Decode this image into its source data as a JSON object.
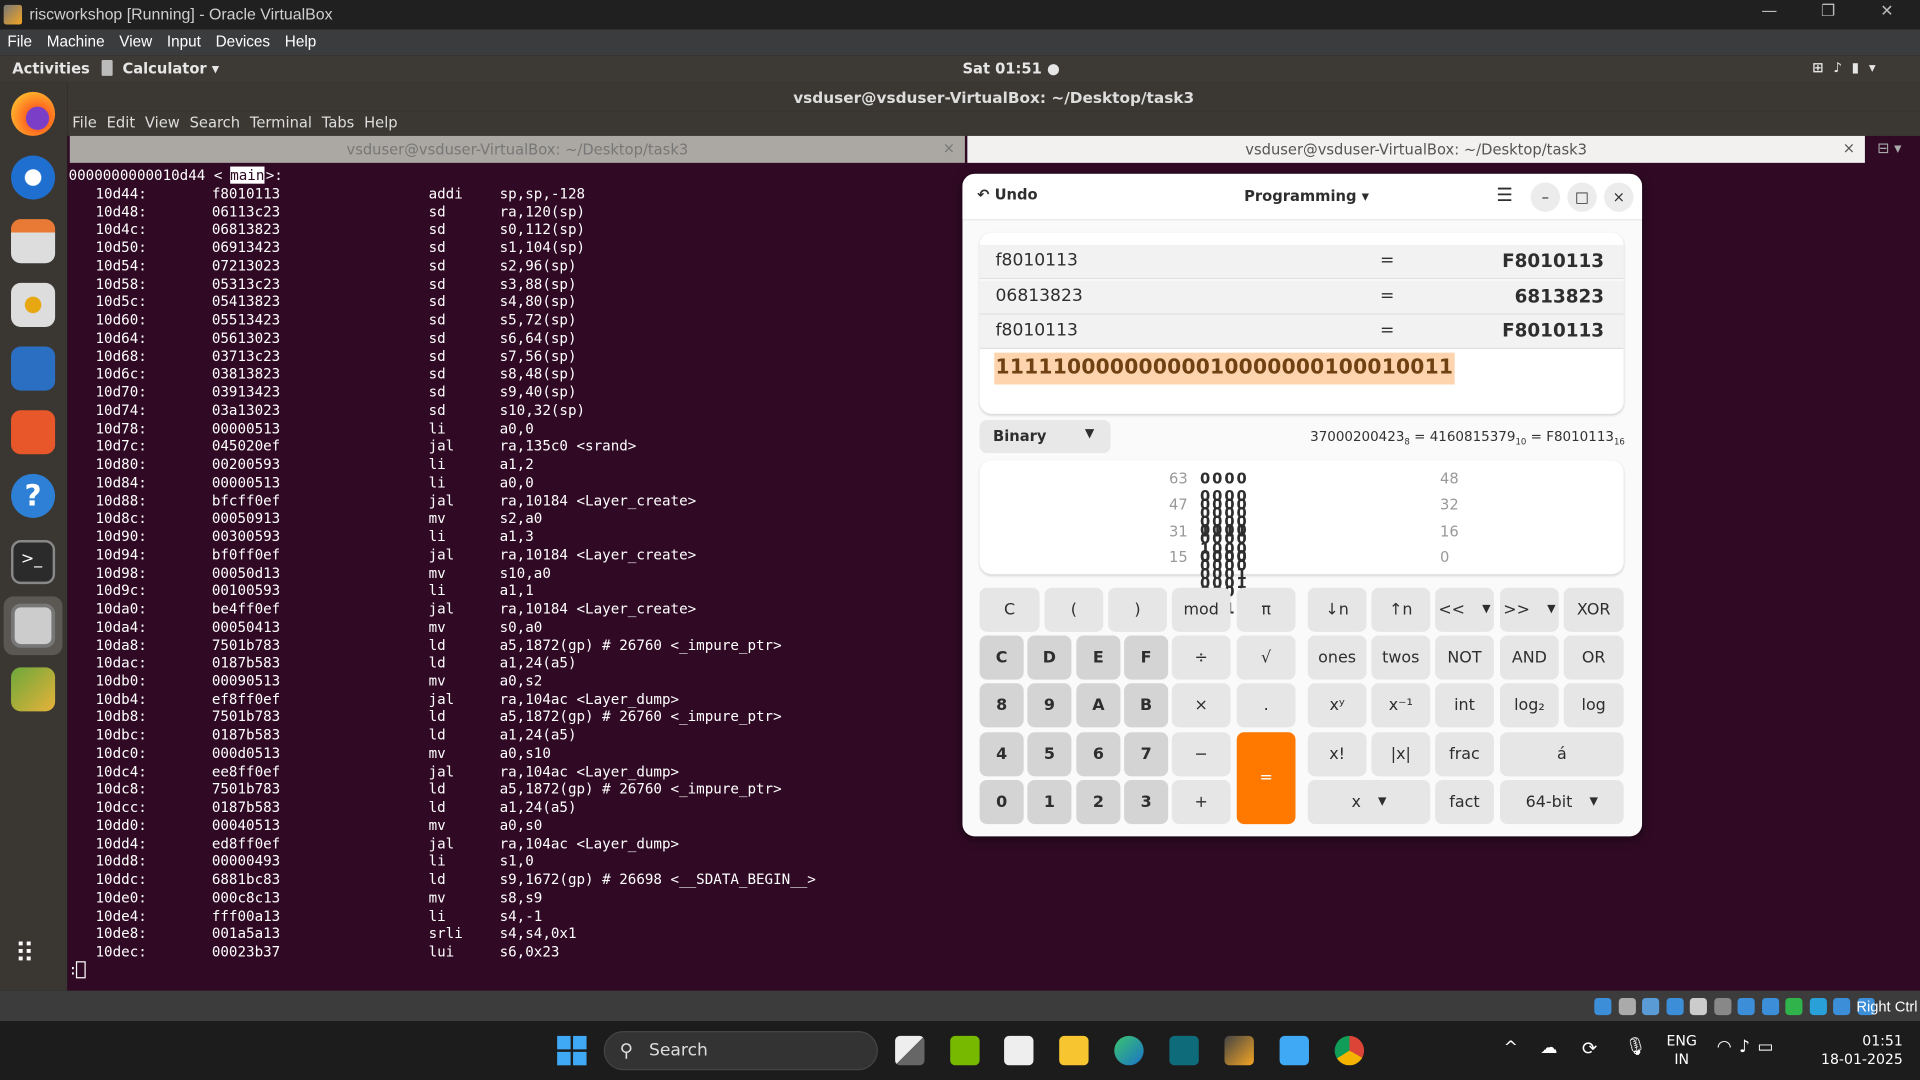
{
  "vbox": {
    "title": "riscworkshop [Running] - Oracle VirtualBox",
    "menu": [
      "File",
      "Machine",
      "View",
      "Input",
      "Devices",
      "Help"
    ],
    "status_host_key": "Right Ctrl"
  },
  "ubuntu": {
    "activities": "Activities",
    "app_menu": "Calculator",
    "clock": "Sat 01:51 ●"
  },
  "dock": {
    "items": [
      "firefox-icon",
      "thunderbird-icon",
      "files-icon",
      "rhythmbox-icon",
      "libreoffice-writer-icon",
      "app-center-icon",
      "help-icon",
      "terminal-icon",
      "calculator-icon",
      "image-viewer-icon"
    ],
    "apps_grid": "show-apps-icon"
  },
  "terminal": {
    "title": "vsduser@vsduser-VirtualBox: ~/Desktop/task3",
    "menu": [
      "File",
      "Edit",
      "View",
      "Search",
      "Terminal",
      "Tabs",
      "Help"
    ],
    "tabs": [
      "vsduser@vsduser-VirtualBox: ~/Desktop/task3",
      "vsduser@vsduser-VirtualBox: ~/Desktop/task3"
    ],
    "header_prefix": "0000000000010d44 <",
    "header_symbol": "main",
    "header_suffix": ">:",
    "lines": [
      [
        "10d44:",
        "f8010113",
        "addi",
        "sp,sp,-128"
      ],
      [
        "10d48:",
        "06113c23",
        "sd",
        "ra,120(sp)"
      ],
      [
        "10d4c:",
        "06813823",
        "sd",
        "s0,112(sp)"
      ],
      [
        "10d50:",
        "06913423",
        "sd",
        "s1,104(sp)"
      ],
      [
        "10d54:",
        "07213023",
        "sd",
        "s2,96(sp)"
      ],
      [
        "10d58:",
        "05313c23",
        "sd",
        "s3,88(sp)"
      ],
      [
        "10d5c:",
        "05413823",
        "sd",
        "s4,80(sp)"
      ],
      [
        "10d60:",
        "05513423",
        "sd",
        "s5,72(sp)"
      ],
      [
        "10d64:",
        "05613023",
        "sd",
        "s6,64(sp)"
      ],
      [
        "10d68:",
        "03713c23",
        "sd",
        "s7,56(sp)"
      ],
      [
        "10d6c:",
        "03813823",
        "sd",
        "s8,48(sp)"
      ],
      [
        "10d70:",
        "03913423",
        "sd",
        "s9,40(sp)"
      ],
      [
        "10d74:",
        "03a13023",
        "sd",
        "s10,32(sp)"
      ],
      [
        "10d78:",
        "00000513",
        "li",
        "a0,0"
      ],
      [
        "10d7c:",
        "045020ef",
        "jal",
        "ra,135c0 <srand>"
      ],
      [
        "10d80:",
        "00200593",
        "li",
        "a1,2"
      ],
      [
        "10d84:",
        "00000513",
        "li",
        "a0,0"
      ],
      [
        "10d88:",
        "bfcff0ef",
        "jal",
        "ra,10184 <Layer_create>"
      ],
      [
        "10d8c:",
        "00050913",
        "mv",
        "s2,a0"
      ],
      [
        "10d90:",
        "00300593",
        "li",
        "a1,3"
      ],
      [
        "10d94:",
        "bf0ff0ef",
        "jal",
        "ra,10184 <Layer_create>"
      ],
      [
        "10d98:",
        "00050d13",
        "mv",
        "s10,a0"
      ],
      [
        "10d9c:",
        "00100593",
        "li",
        "a1,1"
      ],
      [
        "10da0:",
        "be4ff0ef",
        "jal",
        "ra,10184 <Layer_create>"
      ],
      [
        "10da4:",
        "00050413",
        "mv",
        "s0,a0"
      ],
      [
        "10da8:",
        "7501b783",
        "ld",
        "a5,1872(gp) # 26760 <_impure_ptr>"
      ],
      [
        "10dac:",
        "0187b583",
        "ld",
        "a1,24(a5)"
      ],
      [
        "10db0:",
        "00090513",
        "mv",
        "a0,s2"
      ],
      [
        "10db4:",
        "ef8ff0ef",
        "jal",
        "ra,104ac <Layer_dump>"
      ],
      [
        "10db8:",
        "7501b783",
        "ld",
        "a5,1872(gp) # 26760 <_impure_ptr>"
      ],
      [
        "10dbc:",
        "0187b583",
        "ld",
        "a1,24(a5)"
      ],
      [
        "10dc0:",
        "000d0513",
        "mv",
        "a0,s10"
      ],
      [
        "10dc4:",
        "ee8ff0ef",
        "jal",
        "ra,104ac <Layer_dump>"
      ],
      [
        "10dc8:",
        "7501b783",
        "ld",
        "a5,1872(gp) # 26760 <_impure_ptr>"
      ],
      [
        "10dcc:",
        "0187b583",
        "ld",
        "a1,24(a5)"
      ],
      [
        "10dd0:",
        "00040513",
        "mv",
        "a0,s0"
      ],
      [
        "10dd4:",
        "ed8ff0ef",
        "jal",
        "ra,104ac <Layer_dump>"
      ],
      [
        "10dd8:",
        "00000493",
        "li",
        "s1,0"
      ],
      [
        "10ddc:",
        "6881bc83",
        "ld",
        "s9,1672(gp) # 26698 <__SDATA_BEGIN__>"
      ],
      [
        "10de0:",
        "000c8c13",
        "mv",
        "s8,s9"
      ],
      [
        "10de4:",
        "fff00a13",
        "li",
        "s4,-1"
      ],
      [
        "10de8:",
        "001a5a13",
        "srli",
        "s4,s4,0x1"
      ],
      [
        "10dec:",
        "00023b37",
        "lui",
        "s6,0x23"
      ]
    ],
    "prompt": ":"
  },
  "calculator": {
    "undo": "Undo",
    "mode": "Programming",
    "history": [
      {
        "expr": "f8010113",
        "eq": "=",
        "result": "F8010113"
      },
      {
        "expr": " 06813823",
        "eq": "=",
        "result": "6813823"
      },
      {
        "expr": "f8010113",
        "eq": "=",
        "result": "F8010113"
      }
    ],
    "current": "11111000000000010000000100010011",
    "base": "Binary",
    "conv": {
      "oct": "37000200423",
      "oct_sub": "8",
      "dec": "4160815379",
      "dec_sub": "10",
      "hex": "F8010113",
      "hex_sub": "16",
      "eq": "="
    },
    "bits": [
      {
        "hi": "63",
        "val": "0000 0000 0000 0000",
        "lo": "48"
      },
      {
        "hi": "47",
        "val": "0000 0000 0000 0000",
        "lo": "32"
      },
      {
        "hi": "31",
        "val": "1111 1000 0000 0001",
        "lo": "16"
      },
      {
        "hi": "15",
        "val": "0000 0001 0001 0011",
        "lo": "0"
      }
    ],
    "buttons_left": [
      "C",
      "(",
      ")",
      "mod",
      "π",
      "C",
      "D",
      "E",
      "F",
      "÷",
      "√",
      "8",
      "9",
      "A",
      "B",
      "×",
      ".",
      "4",
      "5",
      "6",
      "7",
      "−",
      "=",
      "0",
      "1",
      "2",
      "3",
      "+"
    ],
    "buttons_right": [
      "↓n",
      "↑n",
      "<<",
      "&gt;&gt;",
      "XOR",
      "ones",
      "twos",
      "NOT",
      "AND",
      "OR",
      "xʸ",
      "x⁻¹",
      "int",
      "log₂",
      "log",
      "x!",
      "|x|",
      "frac",
      "á",
      "x",
      "fact",
      "64-bit"
    ],
    "accent": "#ff7800"
  },
  "taskbar": {
    "search": "Search",
    "lang1": "ENG",
    "lang2": "IN",
    "time": "01:51",
    "date": "18-01-2025"
  }
}
